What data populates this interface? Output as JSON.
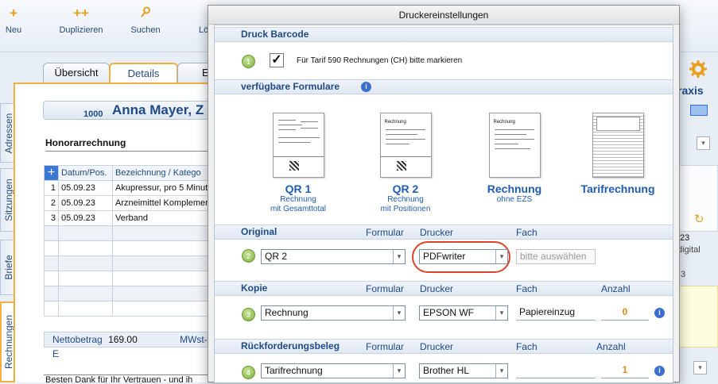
{
  "toolbar": {
    "new_label": "Neu",
    "duplicate_label": "Duplizieren",
    "search_label": "Suchen",
    "delete_label_partial": "Lö"
  },
  "tabs": [
    "Übersicht",
    "Details",
    "E"
  ],
  "side_tabs": [
    "Adressen",
    "Sitzungen",
    "Briefe",
    "Rechnungen"
  ],
  "record": {
    "number": "1000",
    "name": "Anna Mayer, Z",
    "invoice_type": "Honorarrechnung",
    "columns": [
      "Datum/Pos.",
      "Bezeichnung / Katego"
    ],
    "rows": [
      {
        "pos": "1",
        "date": "05.09.23",
        "desc": "Akupressur, pro 5 Minut"
      },
      {
        "pos": "2",
        "date": "05.09.23",
        "desc": "Arzneimittel Komplemen"
      },
      {
        "pos": "3",
        "date": "05.09.23",
        "desc": "Verband"
      }
    ],
    "net_label": "Nettobetrag",
    "net_value": "169.00",
    "vat_label": "MWst-E",
    "footer_text": "Besten Dank für Ihr Vertrauen - und ih"
  },
  "right_panel": {
    "title_partial": "raxis",
    "num_partial": "23",
    "digital_partial": "digital",
    "three": "3"
  },
  "dialog": {
    "title": "Druckereinstellungen",
    "barcode_section": "Druck Barcode",
    "barcode_badge": "1",
    "barcode_checkbox_label": "Für Tarif 590 Rechnungen (CH) bitte markieren",
    "barcode_checked": true,
    "forms_section": "verfügbare Formulare",
    "forms": [
      {
        "name": "QR 1",
        "sub1": "Rechnung",
        "sub2": "mit Gesamttotal",
        "doc_text": ""
      },
      {
        "name": "QR 2",
        "sub1": "Rechnung",
        "sub2": "mit Positionen",
        "doc_text": "Rechnung"
      },
      {
        "name": "Rechnung",
        "sub1": "ohne EZS",
        "sub2": "",
        "doc_text": "Rechnung"
      },
      {
        "name": "Tarifrechnung",
        "sub1": "",
        "sub2": "",
        "doc_text": ""
      }
    ],
    "col_formular": "Formular",
    "col_drucker": "Drucker",
    "col_fach": "Fach",
    "col_anzahl": "Anzahl",
    "original": {
      "label": "Original",
      "badge": "2",
      "form": "QR 2",
      "printer": "PDFwriter",
      "tray_placeholder": "bitte auswählen"
    },
    "copy": {
      "label": "Kopie",
      "badge": "3",
      "form": "Rechnung",
      "printer": "EPSON WF",
      "printer_line2": "...",
      "tray": "Papiereinzug",
      "count": "0"
    },
    "refund": {
      "label": "Rückforderungsbeleg",
      "badge": "4",
      "form": "Tarifrechnung",
      "printer": "Brother HL",
      "printer_line2": "...",
      "tray": "",
      "count": "1"
    },
    "colors": {
      "accent": "#1f4a85",
      "highlight": "#d9442a",
      "count": "#e08a1e"
    }
  }
}
